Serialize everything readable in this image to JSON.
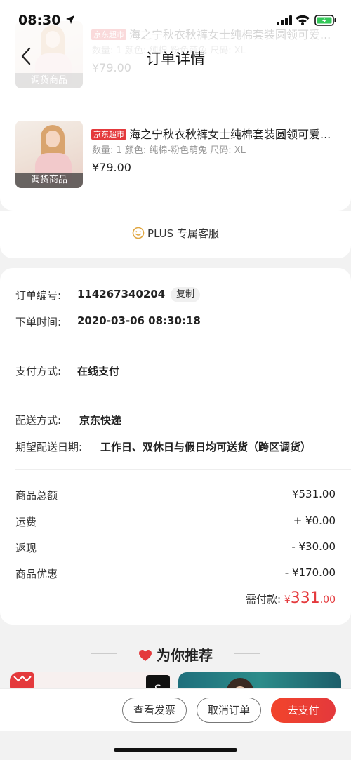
{
  "status_bar": {
    "time": "08:30"
  },
  "header": {
    "title": "订单详情"
  },
  "products": [
    {
      "tag": "京东超市",
      "title": "海之宁秋衣秋裤女士纯棉套装圆领可爱...",
      "spec": "数量: 1  颜色: 纯棉-粉色萌兔  尺码: XL",
      "price": "¥79.00",
      "thumb_label": "调货商品"
    },
    {
      "tag": "京东超市",
      "title": "海之宁秋衣秋裤女士纯棉套装圆领可爱...",
      "spec": "数量: 1  颜色: 纯棉-粉色萌兔  尺码: XL",
      "price": "¥79.00",
      "thumb_label": "调货商品"
    }
  ],
  "service": {
    "label": "PLUS 专属客服"
  },
  "order": {
    "number_label": "订单编号:",
    "number": "114267340204",
    "copy_label": "复制",
    "time_label": "下单时间:",
    "time": "2020-03-06 08:30:18",
    "payment_label": "支付方式:",
    "payment": "在线支付",
    "delivery_label": "配送方式:",
    "delivery": "京东快递",
    "date_label": "期望配送日期:",
    "date": "工作日、双休日与假日均可送货（跨区调货）"
  },
  "amounts": [
    {
      "label": "商品总额",
      "value": "¥531.00"
    },
    {
      "label": "运费",
      "value": "+ ¥0.00"
    },
    {
      "label": "返现",
      "value": "- ¥30.00"
    },
    {
      "label": "商品优惠",
      "value": "- ¥170.00"
    }
  ],
  "payable": {
    "label": "需付款:",
    "currency": "¥",
    "integer": "331",
    "decimal": ".00"
  },
  "recommend": {
    "title": "为你推荐"
  },
  "actions": {
    "invoice": "查看发票",
    "cancel": "取消订单",
    "pay": "去支付"
  },
  "colors": {
    "accent": "#e4393c",
    "background": "#f2f2f2"
  }
}
